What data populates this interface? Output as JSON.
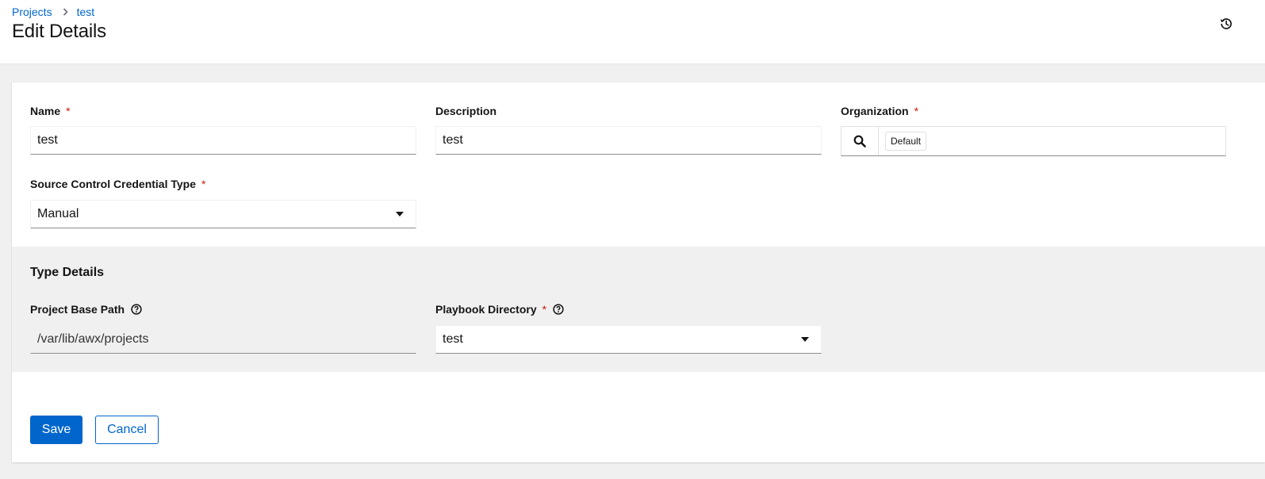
{
  "breadcrumb": {
    "parent": "Projects",
    "current": "test"
  },
  "header": {
    "title": "Edit Details",
    "history_icon": "history-icon"
  },
  "form": {
    "name": {
      "label": "Name",
      "required": "*",
      "value": "test"
    },
    "description": {
      "label": "Description",
      "value": "test"
    },
    "organization": {
      "label": "Organization",
      "required": "*",
      "selected_chip": "Default",
      "search_icon": "search-icon"
    },
    "scm_type": {
      "label": "Source Control Credential Type",
      "required": "*",
      "value": "Manual"
    }
  },
  "type_details": {
    "title": "Type Details",
    "base_path": {
      "label": "Project Base Path",
      "value": "/var/lib/awx/projects",
      "help_icon": "help-icon"
    },
    "playbook_dir": {
      "label": "Playbook Directory",
      "required": "*",
      "value": "test",
      "help_icon": "help-icon"
    }
  },
  "actions": {
    "save": "Save",
    "cancel": "Cancel"
  },
  "colors": {
    "accent": "#0066cc",
    "required": "#c9190b",
    "page_bg": "#f0f0f0"
  }
}
